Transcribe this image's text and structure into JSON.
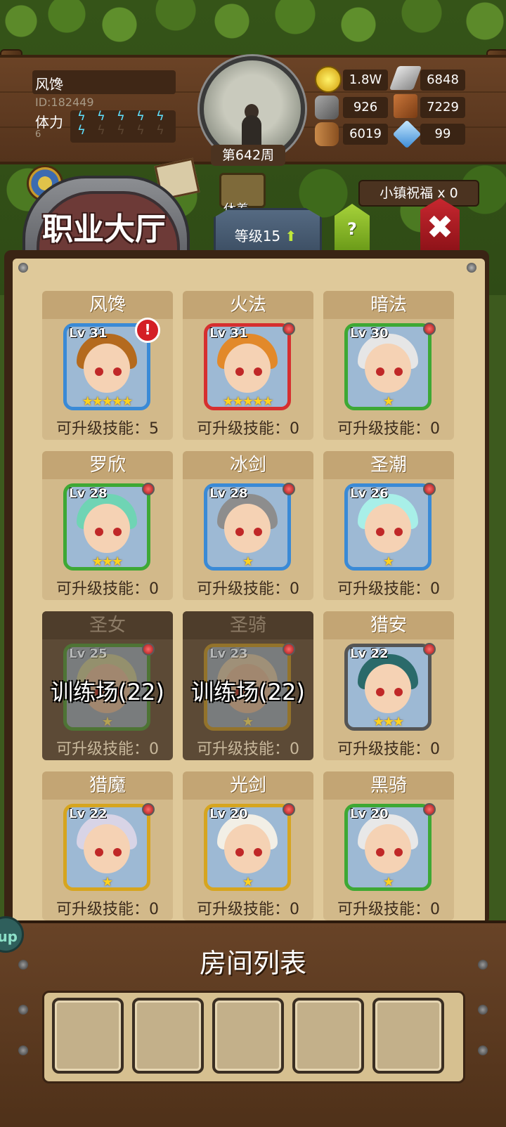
{
  "player": {
    "name": "风馋",
    "id": "ID:182449",
    "stamina_label": "体力",
    "stamina_value": "6",
    "stamina_full": 6,
    "stamina_max": 10
  },
  "week": "第642周",
  "resources": {
    "gold": "1.8W",
    "iron": "6848",
    "stone": "926",
    "leather": "7229",
    "wood": "6019",
    "crystal": "99"
  },
  "hall_title": "职业大厅",
  "rest_label": "休养",
  "level_button": "等级15",
  "help_button": "?",
  "blessing": "小镇祝福 x 0",
  "heroes": [
    {
      "name": "风馋",
      "level": "Lv 31",
      "stars": "★★★★★",
      "skill": "可升级技能：5",
      "alert": "!",
      "locked": false,
      "frame": "#3a8ad6",
      "hair": "#b46a1e"
    },
    {
      "name": "火法",
      "level": "Lv 31",
      "stars": "★★★★★",
      "skill": "可升级技能：0",
      "locked": false,
      "frame": "#d62f2f",
      "hair": "#e2892a"
    },
    {
      "name": "暗法",
      "level": "Lv 30",
      "stars": "★",
      "skill": "可升级技能：0",
      "locked": false,
      "frame": "#3ea834",
      "hair": "#e6e6e6"
    },
    {
      "name": "罗欣",
      "level": "Lv 28",
      "stars": "★★★",
      "skill": "可升级技能：0",
      "locked": false,
      "frame": "#3ea834",
      "hair": "#6fd4b4"
    },
    {
      "name": "冰剑",
      "level": "Lv 28",
      "stars": "★",
      "skill": "可升级技能：0",
      "locked": false,
      "frame": "#3a8ad6",
      "hair": "#8d8d8d"
    },
    {
      "name": "圣潮",
      "level": "Lv 26",
      "stars": "★",
      "skill": "可升级技能：0",
      "locked": false,
      "frame": "#3a8ad6",
      "hair": "#a8efe8"
    },
    {
      "name": "圣女",
      "level": "Lv 25",
      "stars": "★",
      "skill": "可升级技能：0",
      "locked": true,
      "train": "训练场(22)",
      "frame": "#3ea834",
      "hair": "#d9e6b0"
    },
    {
      "name": "圣骑",
      "level": "Lv 23",
      "stars": "★",
      "skill": "可升级技能：0",
      "locked": true,
      "train": "训练场(22)",
      "frame": "#d6a51f",
      "hair": "#f0e6c8"
    },
    {
      "name": "猎安",
      "level": "Lv 22",
      "stars": "★★★",
      "skill": "可升级技能：0",
      "locked": false,
      "frame": "#555555",
      "hair": "#2a6a6a"
    },
    {
      "name": "猎魔",
      "level": "Lv 22",
      "stars": "★",
      "skill": "可升级技能：0",
      "locked": false,
      "frame": "#d6a51f",
      "hair": "#d8d4e6"
    },
    {
      "name": "光剑",
      "level": "Lv 20",
      "stars": "★",
      "skill": "可升级技能：0",
      "locked": false,
      "frame": "#d6a51f",
      "hair": "#f2efe6"
    },
    {
      "name": "黑骑",
      "level": "Lv 20",
      "stars": "★",
      "skill": "可升级技能：0",
      "locked": false,
      "frame": "#3ea834",
      "hair": "#e8e8e8"
    }
  ],
  "room_list_title": "房间列表",
  "room_slots": 5,
  "side_button": "up"
}
